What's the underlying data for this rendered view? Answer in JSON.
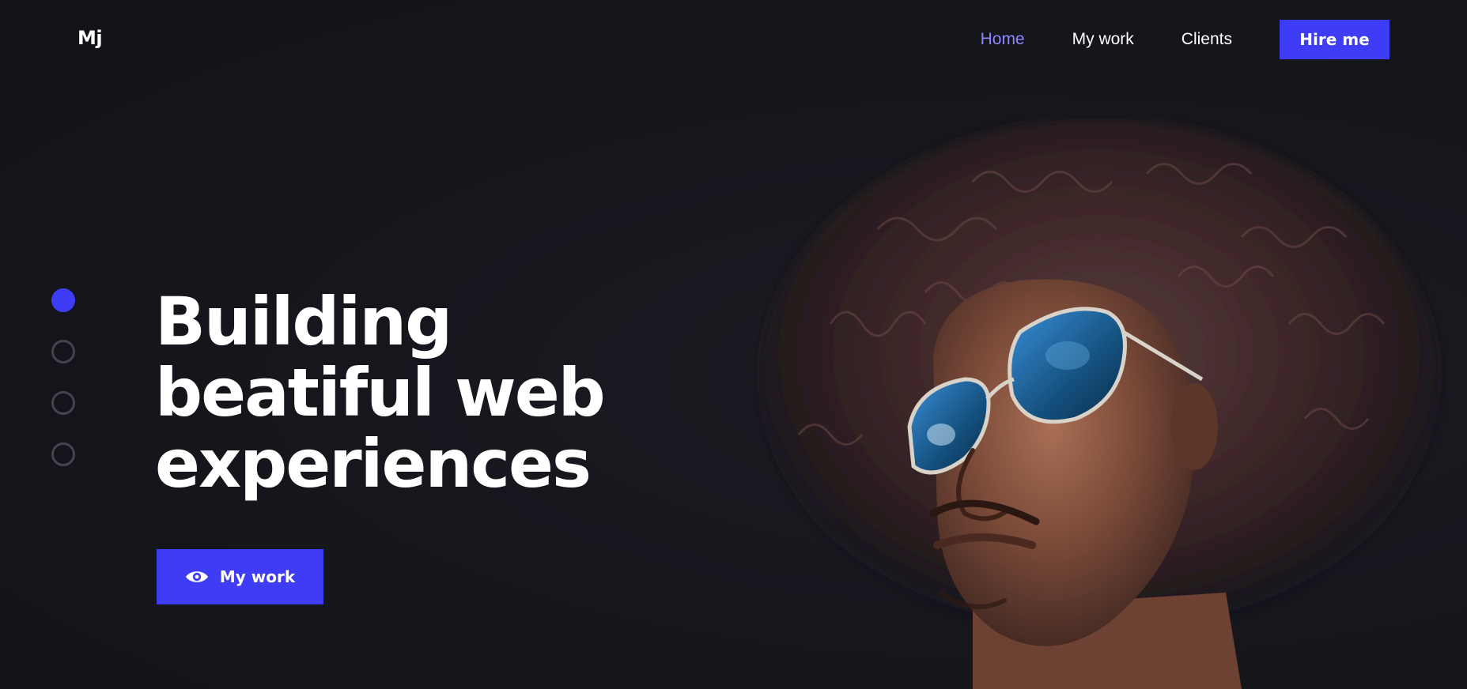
{
  "header": {
    "logo": "Mj",
    "nav": [
      {
        "label": "Home",
        "active": true
      },
      {
        "label": "My work",
        "active": false
      },
      {
        "label": "Clients",
        "active": false
      }
    ],
    "hire_label": "Hire me"
  },
  "hero": {
    "title_lines": [
      "Building",
      "beatiful web",
      "experiences"
    ],
    "cta_label": "My work",
    "cta_icon": "eye-icon"
  },
  "slider": {
    "count": 4,
    "active_index": 0
  },
  "colors": {
    "background": "#16161d",
    "accent": "#3f3cf6",
    "active_link": "#8c87ff",
    "text": "#ffffff",
    "inactive_dot": "#44444f"
  },
  "image": {
    "subject": "portrait-photo"
  }
}
